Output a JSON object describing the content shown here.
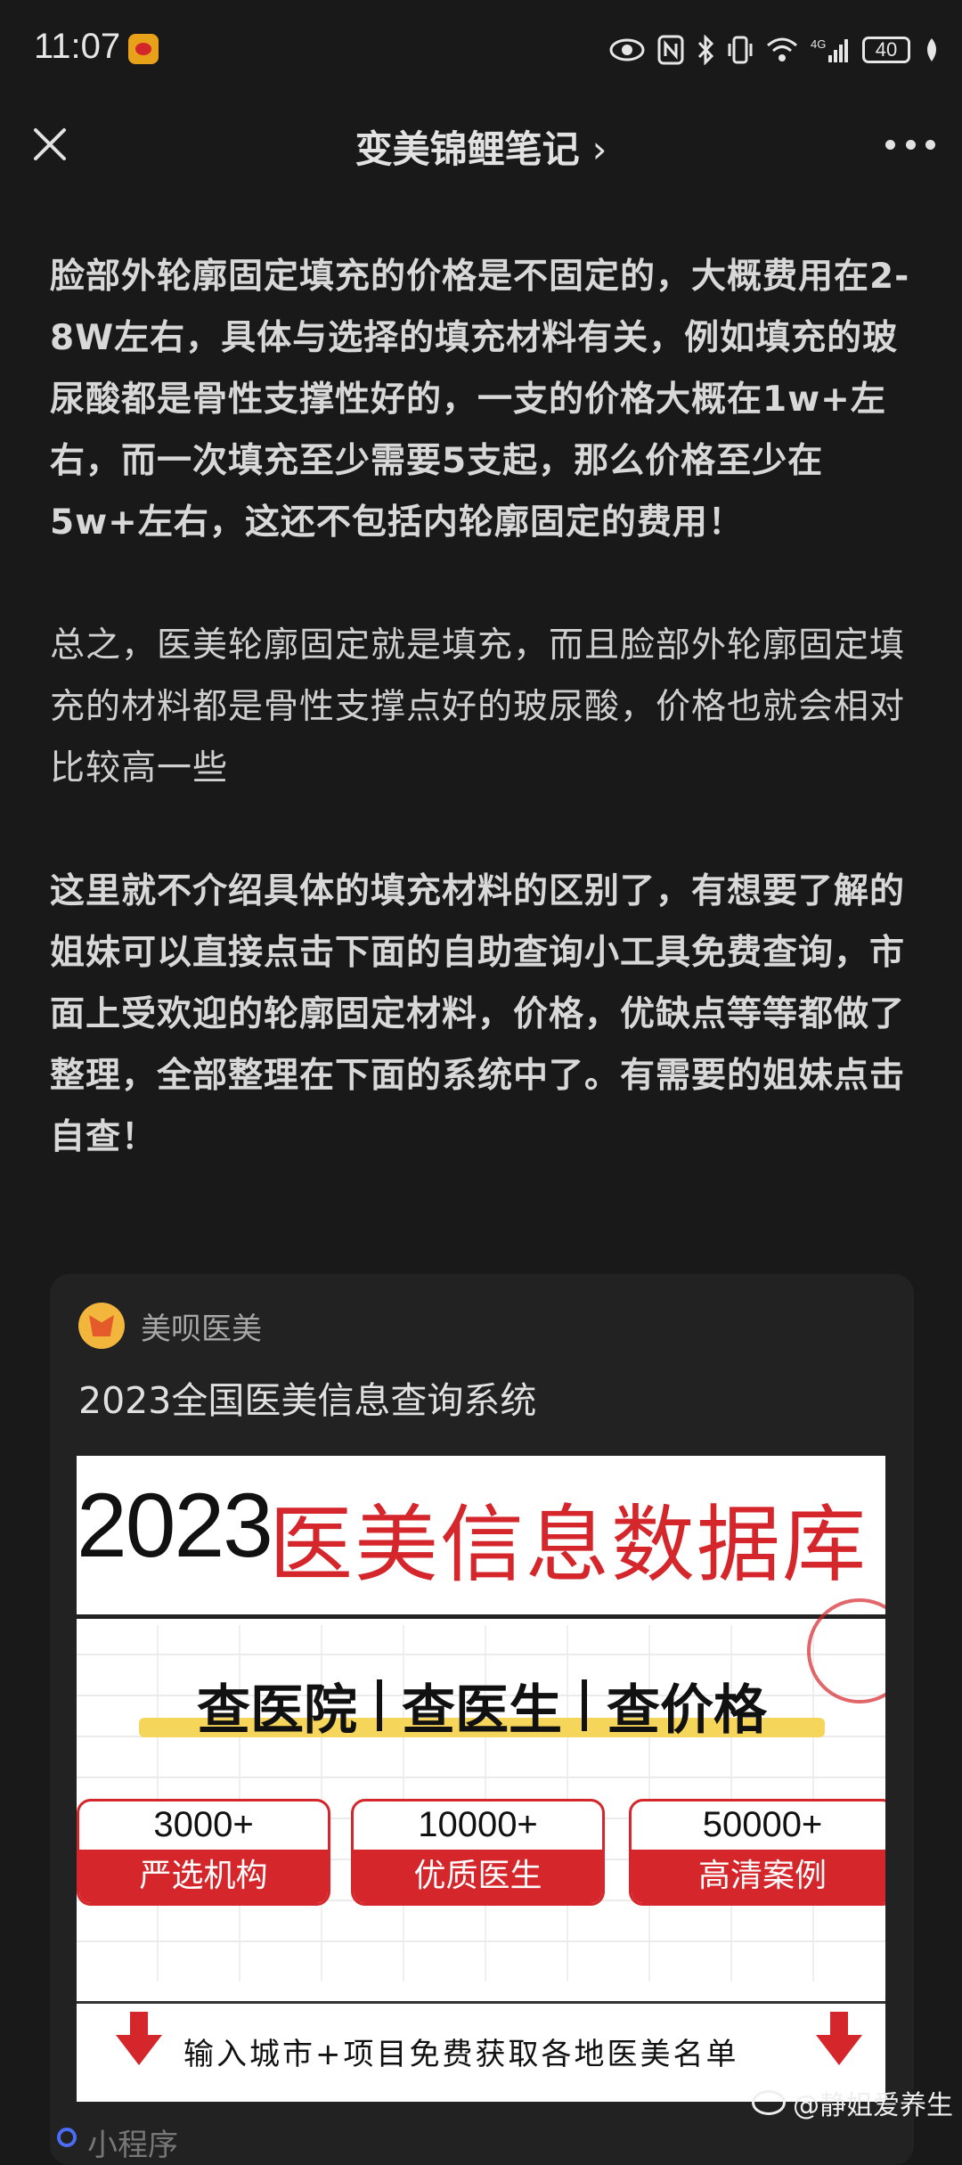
{
  "status_bar": {
    "time": "11:07",
    "battery": "40",
    "network": "4G",
    "icons": [
      "eye-icon",
      "nfc-icon",
      "bluetooth-icon",
      "vibrate-icon",
      "wifi-icon",
      "signal-icon",
      "battery-icon",
      "leaf-icon"
    ]
  },
  "nav": {
    "title": "变美锦鲤笔记",
    "chevron": "›"
  },
  "article": {
    "paragraphs": [
      "脸部外轮廓固定填充的价格是不固定的，大概费用在2-8W左右，具体与选择的填充材料有关，例如填充的玻尿酸都是骨性支撑性好的，一支的价格大概在1w+左右，而一次填充至少需要5支起，那么价格至少在5w+左右，这还不包括内轮廓固定的费用！",
      "总之，医美轮廓固定就是填充，而且脸部外轮廓固定填充的材料都是骨性支撑点好的玻尿酸，价格也就会相对比较高一些",
      "这里就不介绍具体的填充材料的区别了，有想要了解的姐妹可以直接点击下面的自助查询小工具免费查询，市面上受欢迎的轮廓固定材料，价格，优缺点等等都做了整理，全部整理在下面的系统中了。有需要的姐妹点击自查！"
    ]
  },
  "card": {
    "brand": "美呗医美",
    "title": "2023全国医美信息查询系统",
    "poster": {
      "year": "2023",
      "slogan": "医美信息数据库",
      "search_items": [
        "查医院",
        "查医生",
        "查价格"
      ],
      "stats": [
        {
          "num": "3000+",
          "label": "严选机构"
        },
        {
          "num": "10000+",
          "label": "优质医生"
        },
        {
          "num": "50000+",
          "label": "高清案例"
        }
      ],
      "footer": "输入城市+项目免费获取各地医美名单"
    },
    "next_label": "小程序"
  },
  "watermark": "@静姐爱养生",
  "colors": {
    "background": "#191919",
    "accent_red": "#d4262b",
    "highlight_yellow": "#f6d65a"
  }
}
